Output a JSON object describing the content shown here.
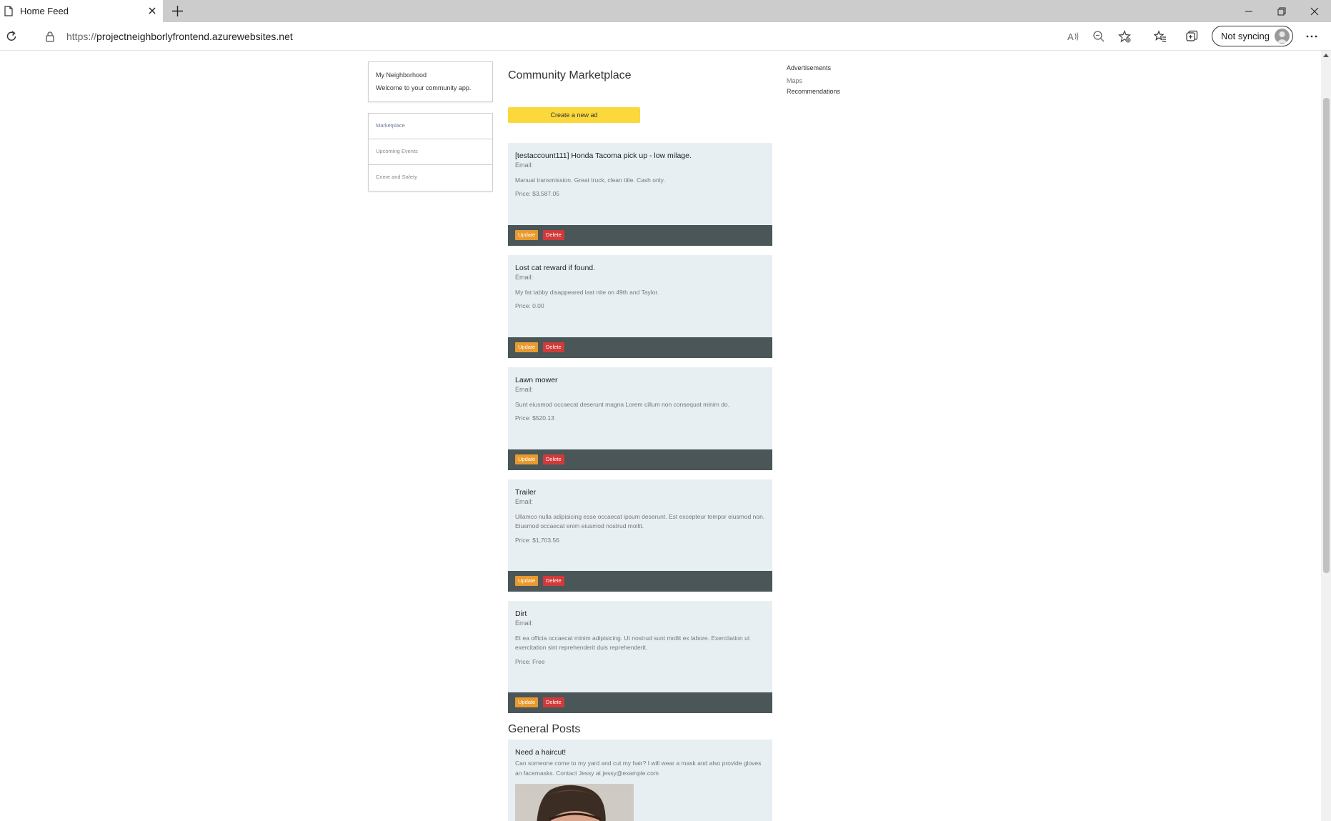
{
  "browser": {
    "tab_title": "Home Feed",
    "url_protocol": "https://",
    "url_host": "projectneighborlyfrontend.azurewebsites.net",
    "sync_label": "Not syncing",
    "icons": [
      "page-icon",
      "close-icon",
      "plus-icon",
      "minimize-icon",
      "restore-icon",
      "close-icon",
      "refresh-icon",
      "lock-icon",
      "read-aloud-icon",
      "zoom-out-icon",
      "add-favorite-icon",
      "favorites-icon",
      "collections-icon",
      "more-icon"
    ]
  },
  "home": {
    "title": "My Neighborhood",
    "subtitle": "Welcome to your community app."
  },
  "nav": {
    "items": [
      {
        "label": "Marketplace"
      },
      {
        "label": "Upcoming Events"
      },
      {
        "label": "Crime and Safety"
      }
    ]
  },
  "marketplace": {
    "title": "Community Marketplace",
    "create_label": "Create a new ad",
    "update_label": "Update",
    "delete_label": "Delete",
    "ads": [
      {
        "title": "[testaccount111] Honda Tacoma pick up - low milage.",
        "email": "Email:",
        "description": "Manual transmission. Great truck, clean title. Cash only.",
        "price": "Price: $3,587.05"
      },
      {
        "title": "Lost cat reward if found.",
        "email": "Email:",
        "description": "My fat tabby disappeared last nite on 49th and Taylor.",
        "price": "Price: 0.00"
      },
      {
        "title": "Lawn mower",
        "email": "Email:",
        "description": "Sunt eiusmod occaecat deserunt magna Lorem cillum non consequat minim do.",
        "price": "Price: $520.13"
      },
      {
        "title": "Trailer",
        "email": "Email:",
        "description": "Ullamco nulla adipisicing esse occaecat ipsum deserunt. Est excepteur tempor eiusmod non. Eiusmod occaecat enim eiusmod nostrud mollit.",
        "price": "Price: $1,703.56"
      },
      {
        "title": "Dirt",
        "email": "Email:",
        "description": "Et ea officia occaecat minim adipisicing. Ut nostrud sunt mollit ex labore. Exercitation ut exercitation sint reprehenderit duis reprehenderit.",
        "price": "Price: Free"
      }
    ]
  },
  "general": {
    "title": "General Posts",
    "posts": [
      {
        "title": "Need a haircut!",
        "body": "Can someone come to my yard and cut my hair? I will wear a mask and also provide gloves an facemasks. Contact Jessy at jessy@example.com"
      }
    ]
  },
  "sidebar": {
    "heading": "Advertisements",
    "links": [
      "Maps",
      "Recommendations"
    ]
  },
  "colors": {
    "accent_yellow": "#fbd83b",
    "card_bg": "#e8eff3",
    "card_footer": "#4a5657",
    "update_orange": "#e89a2e",
    "delete_red": "#d23a3a"
  }
}
